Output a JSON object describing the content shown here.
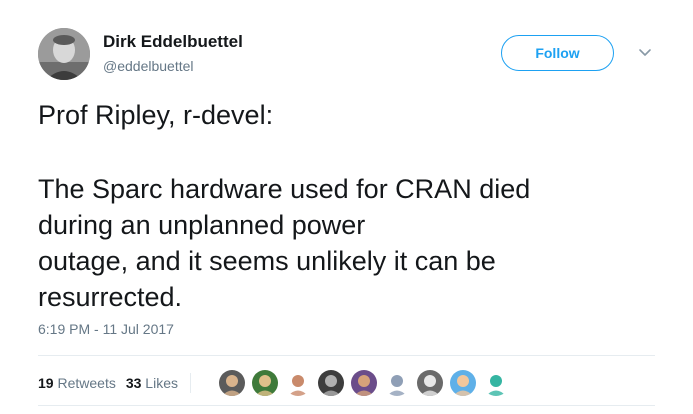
{
  "author": {
    "display_name": "Dirk Eddelbuettel",
    "handle": "@eddelbuettel"
  },
  "actions": {
    "follow_label": "Follow"
  },
  "tweet": {
    "lines": [
      "Prof Ripley, r-devel:",
      "",
      "The Sparc hardware used for CRAN died",
      "during an unplanned power",
      "outage, and it seems unlikely it can be",
      "resurrected."
    ],
    "timestamp": "6:19 PM - 11 Jul 2017"
  },
  "stats": {
    "retweets_count": "19",
    "retweets_label": "Retweets",
    "likes_count": "33",
    "likes_label": "Likes"
  },
  "likers": [
    {
      "icon": "liker-avatar-1",
      "bg": "#5b5b5b",
      "fg": "#d9b38c"
    },
    {
      "icon": "liker-avatar-2",
      "bg": "#3f7a3a",
      "fg": "#e0c08a"
    },
    {
      "icon": "liker-avatar-3",
      "bg": "#ffffff",
      "fg": "#c98a6b"
    },
    {
      "icon": "liker-avatar-4",
      "bg": "#3d3d3d",
      "fg": "#b0b0b0"
    },
    {
      "icon": "liker-avatar-5",
      "bg": "#6b4d8a",
      "fg": "#d6a27a"
    },
    {
      "icon": "liker-avatar-6",
      "bg": "#ffffff",
      "fg": "#8f9fb6"
    },
    {
      "icon": "liker-avatar-7",
      "bg": "#6a6a6a",
      "fg": "#e8e8e8"
    },
    {
      "icon": "liker-avatar-8",
      "bg": "#5fb0e8",
      "fg": "#f3c79c"
    },
    {
      "icon": "liker-avatar-9",
      "bg": "#ffffff",
      "fg": "#35b5a2"
    }
  ],
  "colors": {
    "accent": "#1da1f2",
    "text": "#14171a",
    "muted": "#657786",
    "divider": "#e6ecf0"
  }
}
